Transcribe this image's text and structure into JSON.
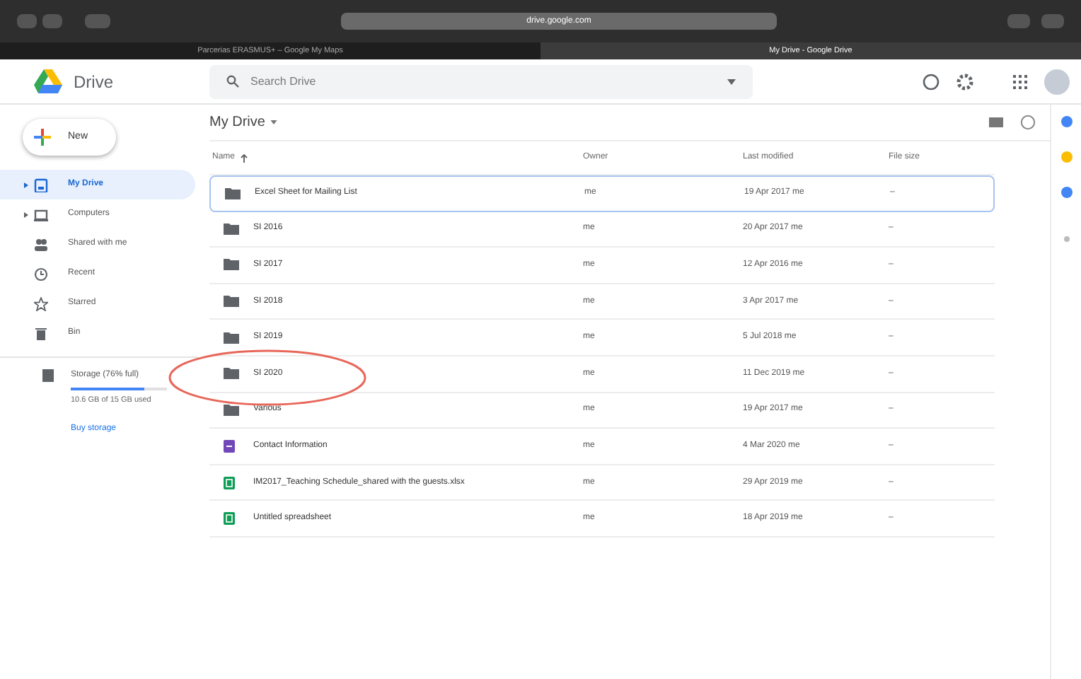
{
  "browser": {
    "address": "drive.google.com",
    "tabs": [
      {
        "label": "Parcerias ERASMUS+ – Google My Maps",
        "selected": false
      },
      {
        "label": "My Drive - Google Drive",
        "selected": true
      }
    ]
  },
  "app": {
    "name": "Drive",
    "search": {
      "placeholder": "Search Drive"
    }
  },
  "new_button": "New",
  "sidebar": {
    "items": [
      {
        "label": "My Drive",
        "expandable": true,
        "selected": true
      },
      {
        "label": "Computers",
        "expandable": true,
        "selected": false
      },
      {
        "label": "Shared with me",
        "expandable": false,
        "selected": false
      },
      {
        "label": "Recent",
        "expandable": false,
        "selected": false
      },
      {
        "label": "Starred",
        "expandable": false,
        "selected": false
      },
      {
        "label": "Bin",
        "expandable": false,
        "selected": false
      }
    ],
    "storage": {
      "label": "Storage (76% full)",
      "level": 0.76,
      "usage": "10.6 GB of 15 GB used",
      "link": "Buy storage"
    }
  },
  "breadcrumb": "My Drive",
  "table": {
    "columns": [
      "Name",
      "Owner",
      "Last modified",
      "File size"
    ],
    "rows": [
      {
        "kind": "folder",
        "name": "Excel Sheet for Mailing List",
        "owner": "me",
        "modified": "19 Apr 2017 me",
        "size": "–",
        "selected": true
      },
      {
        "kind": "folder",
        "name": "SI 2016",
        "owner": "me",
        "modified": "20 Apr 2017 me",
        "size": "–",
        "selected": false
      },
      {
        "kind": "folder",
        "name": "SI 2017",
        "owner": "me",
        "modified": "12 Apr 2016 me",
        "size": "–",
        "selected": false
      },
      {
        "kind": "folder",
        "name": "SI 2018",
        "owner": "me",
        "modified": "3 Apr 2017 me",
        "size": "–",
        "selected": false
      },
      {
        "kind": "folder",
        "name": "SI 2019",
        "owner": "me",
        "modified": "5 Jul 2018 me",
        "size": "–",
        "selected": false
      },
      {
        "kind": "folder",
        "name": "SI 2020",
        "owner": "me",
        "modified": "11 Dec 2019 me",
        "size": "–",
        "selected": false,
        "circled": true
      },
      {
        "kind": "folder",
        "name": "Various",
        "owner": "me",
        "modified": "19 Apr 2017 me",
        "size": "–",
        "selected": false
      },
      {
        "kind": "form",
        "name": "Contact Information",
        "owner": "me",
        "modified": "4 Mar 2020 me",
        "size": "–",
        "selected": false
      },
      {
        "kind": "sheet",
        "name": "IM2017_Teaching Schedule_shared with the guests.xlsx",
        "owner": "me",
        "modified": "29 Apr 2019 me",
        "size": "–",
        "selected": false
      },
      {
        "kind": "sheet",
        "name": "Untitled spreadsheet",
        "owner": "me",
        "modified": "18 Apr 2019 me",
        "size": "–",
        "selected": false
      }
    ]
  }
}
